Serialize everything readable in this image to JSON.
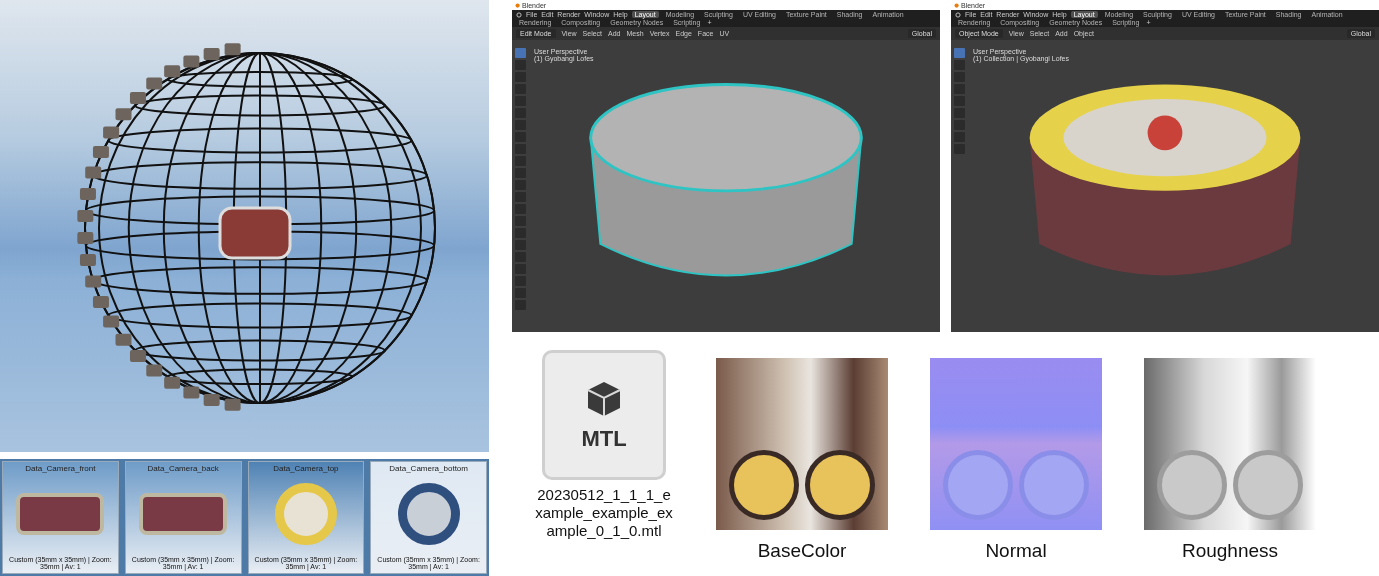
{
  "camera_thumbnails": [
    {
      "title": "Data_Camera_front",
      "footer": "Custom (35mm x 35mm) | Zoom: 35mm | Av: 1",
      "kind": "side"
    },
    {
      "title": "Data_Camera_back",
      "footer": "Custom (35mm x 35mm) | Zoom: 35mm | Av: 1",
      "kind": "side"
    },
    {
      "title": "Data_Camera_top",
      "footer": "Custom (35mm x 35mm) | Zoom: 35mm | Av: 1",
      "kind": "top"
    },
    {
      "title": "Data_Camera_bottom",
      "footer": "Custom (35mm x 35mm) | Zoom: 35mm | Av: 1",
      "kind": "bottom"
    }
  ],
  "blender_windows": [
    {
      "title": "Blender",
      "menu": [
        "File",
        "Edit",
        "Render",
        "Window",
        "Help"
      ],
      "workspace_tabs": [
        {
          "label": "Layout",
          "selected": true
        },
        {
          "label": "Modeling",
          "selected": false
        },
        {
          "label": "Sculpting",
          "selected": false
        },
        {
          "label": "UV Editing",
          "selected": false
        },
        {
          "label": "Texture Paint",
          "selected": false
        },
        {
          "label": "Shading",
          "selected": false
        },
        {
          "label": "Animation",
          "selected": false
        },
        {
          "label": "Rendering",
          "selected": false
        },
        {
          "label": "Compositing",
          "selected": false
        },
        {
          "label": "Geometry Nodes",
          "selected": false
        },
        {
          "label": "Scripting",
          "selected": false
        }
      ],
      "add_tab": "+",
      "mode": "Edit Mode",
      "header_menu": [
        "View",
        "Select",
        "Add",
        "Mesh",
        "Vertex",
        "Edge",
        "Face",
        "UV"
      ],
      "orientation": "Global",
      "viewport_info": [
        "User Perspective",
        "(1) Gyobangi Lofes"
      ],
      "kind": "mesh",
      "tools": [
        {
          "selected": true
        },
        {
          "selected": false
        },
        {
          "selected": false
        },
        {
          "selected": false
        },
        {
          "selected": false
        },
        {
          "selected": false
        },
        {
          "selected": false
        },
        {
          "selected": false
        },
        {
          "selected": false
        },
        {
          "selected": false
        },
        {
          "selected": false
        },
        {
          "selected": false
        },
        {
          "selected": false
        },
        {
          "selected": false
        },
        {
          "selected": false
        },
        {
          "selected": false
        },
        {
          "selected": false
        },
        {
          "selected": false
        },
        {
          "selected": false
        },
        {
          "selected": false
        },
        {
          "selected": false
        },
        {
          "selected": false
        }
      ]
    },
    {
      "title": "Blender",
      "menu": [
        "File",
        "Edit",
        "Render",
        "Window",
        "Help"
      ],
      "workspace_tabs": [
        {
          "label": "Layout",
          "selected": true
        },
        {
          "label": "Modeling",
          "selected": false
        },
        {
          "label": "Sculpting",
          "selected": false
        },
        {
          "label": "UV Editing",
          "selected": false
        },
        {
          "label": "Texture Paint",
          "selected": false
        },
        {
          "label": "Shading",
          "selected": false
        },
        {
          "label": "Animation",
          "selected": false
        },
        {
          "label": "Rendering",
          "selected": false
        },
        {
          "label": "Compositing",
          "selected": false
        },
        {
          "label": "Geometry Nodes",
          "selected": false
        },
        {
          "label": "Scripting",
          "selected": false
        }
      ],
      "add_tab": "+",
      "mode": "Object Mode",
      "header_menu": [
        "View",
        "Select",
        "Add",
        "Object"
      ],
      "orientation": "Global",
      "viewport_info": [
        "User Perspective",
        "(1) Collection | Gyobangi Lofes"
      ],
      "kind": "textured",
      "tools": [
        {
          "selected": true
        },
        {
          "selected": false
        },
        {
          "selected": false
        },
        {
          "selected": false
        },
        {
          "selected": false
        },
        {
          "selected": false
        },
        {
          "selected": false
        },
        {
          "selected": false
        },
        {
          "selected": false
        }
      ]
    }
  ],
  "files": [
    {
      "kind": "file",
      "badge": "MTL",
      "name": "20230512_1_1_1_example_example_example_0_1_0.mtl"
    },
    {
      "kind": "basecolor",
      "name": "BaseColor"
    },
    {
      "kind": "normal",
      "name": "Normal"
    },
    {
      "kind": "roughness",
      "name": "Roughness"
    }
  ]
}
